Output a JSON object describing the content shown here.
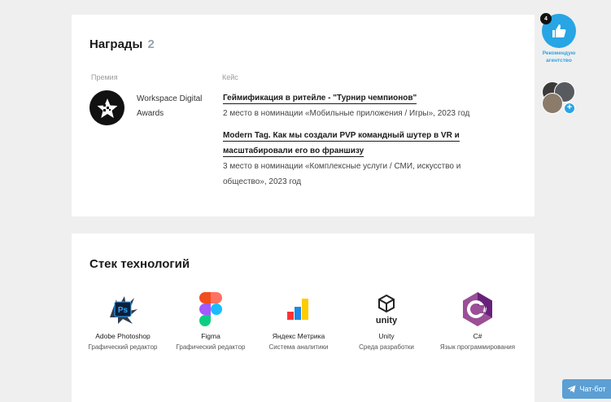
{
  "awards": {
    "title": "Награды",
    "count": "2",
    "col_premia": "Премия",
    "col_case": "Кейс",
    "award_name": "Workspace Digital Awards",
    "cases": [
      {
        "title": "Геймификация в ритейле - \"Турнир чемпионов\"",
        "desc": "2 место в номинации «Мобильные приложения / Игры», 2023 год"
      },
      {
        "title": "Modern Tag. Как мы создали PVP командный шутер в VR и масштабировали его во франшизу",
        "desc": "3 место в номинации «Комплексные услуги / СМИ, искусство и общество», 2023 год"
      }
    ]
  },
  "tech": {
    "title": "Стек технологий",
    "items": [
      {
        "name": "Adobe Photoshop",
        "desc": "Графический редактор",
        "icon": "photoshop-icon"
      },
      {
        "name": "Figma",
        "desc": "Графический редактор",
        "icon": "figma-icon"
      },
      {
        "name": "Яндекс Метрика",
        "desc": "Система аналитики",
        "icon": "yandex-metrika-icon"
      },
      {
        "name": "Unity",
        "desc": "Среда разработки",
        "icon": "unity-icon"
      },
      {
        "name": "C#",
        "desc": "Язык программирования",
        "icon": "csharp-icon"
      }
    ]
  },
  "sidebar": {
    "recommend_count": "4",
    "recommend_label": "Рекомендую агентство"
  },
  "chat": {
    "label": "Чат-бот"
  },
  "colors": {
    "accent": "#27a5e5",
    "chat": "#5b9fd4",
    "background": "#efefef"
  }
}
